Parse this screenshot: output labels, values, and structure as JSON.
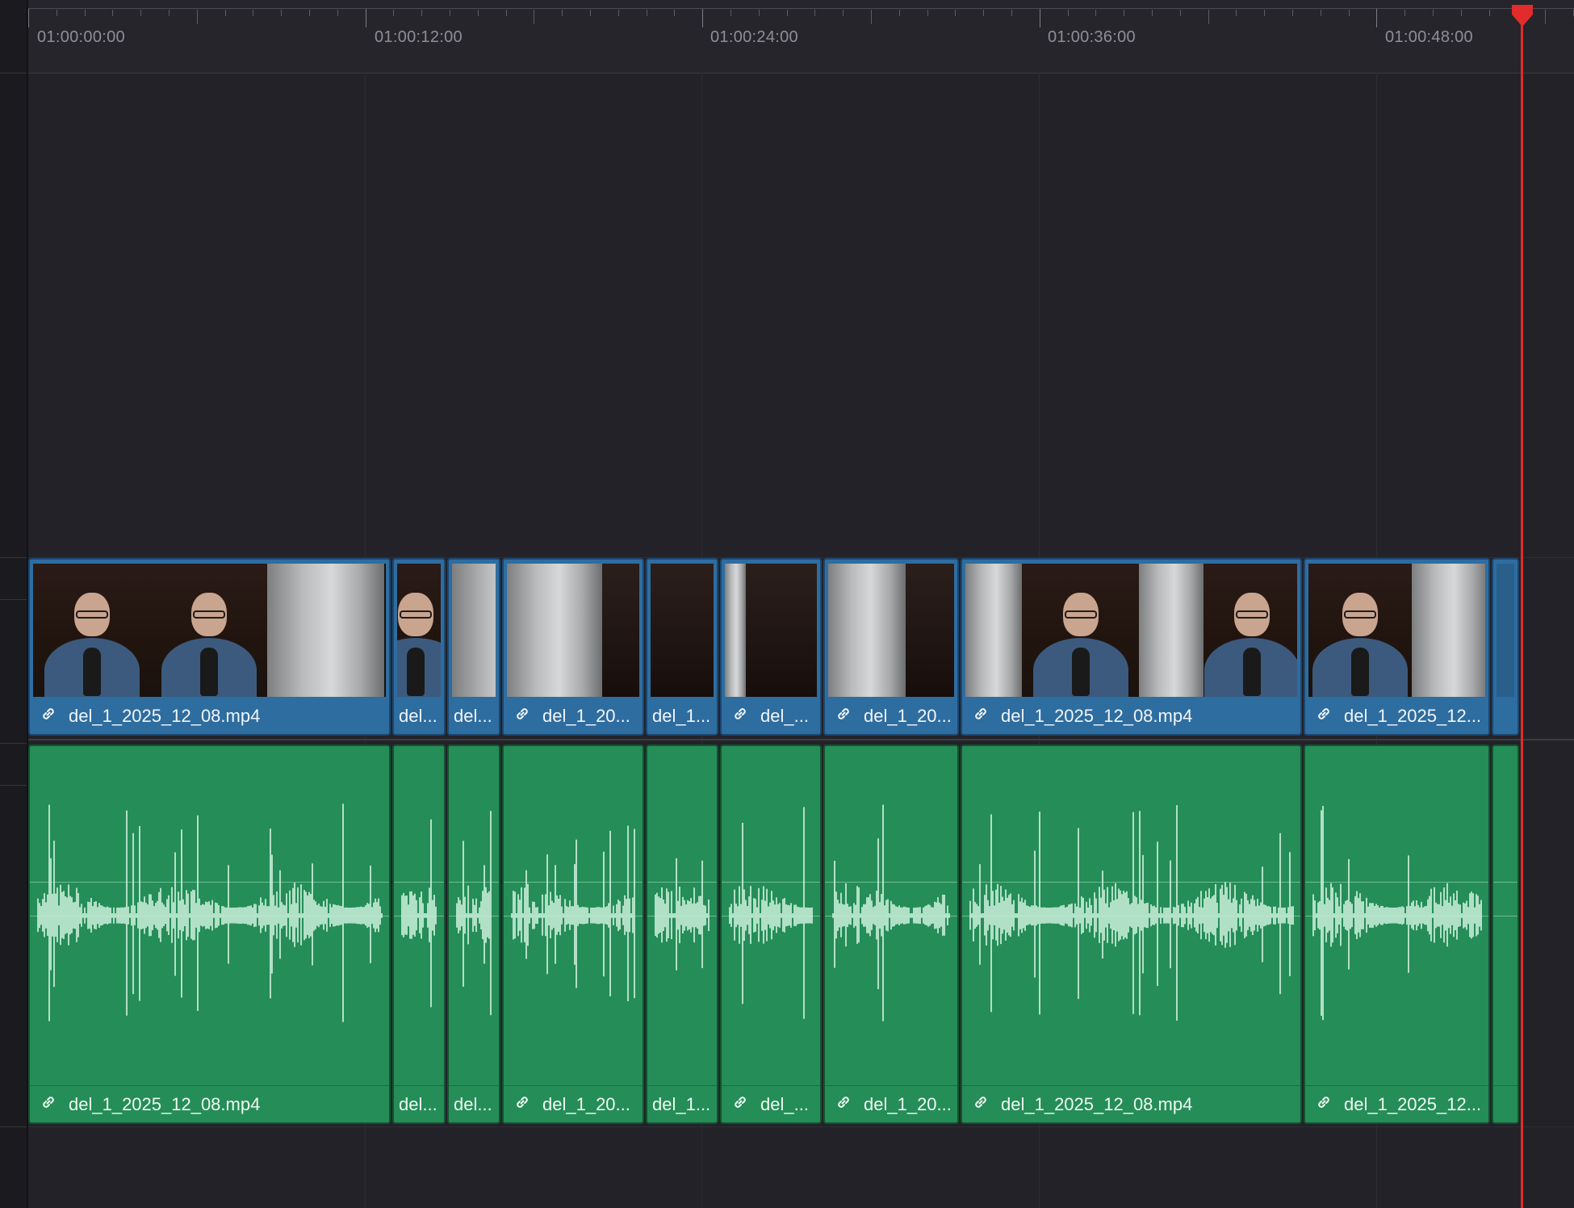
{
  "ruler": {
    "timecodes": [
      "01:00:00:00",
      "01:00:12:00",
      "01:00:24:00",
      "01:00:36:00",
      "01:00:48:00"
    ]
  },
  "video_track": {
    "clips": [
      {
        "label": "del_1_2025_12_08.mp4",
        "linked": true
      },
      {
        "label": "del...",
        "linked": false
      },
      {
        "label": "del...",
        "linked": false
      },
      {
        "label": "del_1_20...",
        "linked": true
      },
      {
        "label": "del_1...",
        "linked": false
      },
      {
        "label": "del_...",
        "linked": true
      },
      {
        "label": "del_1_20...",
        "linked": true
      },
      {
        "label": "del_1_2025_12_08.mp4",
        "linked": true
      },
      {
        "label": "del_1_2025_12...",
        "linked": true
      },
      {
        "label": "",
        "linked": false
      }
    ]
  },
  "audio_track": {
    "clips": [
      {
        "label": "del_1_2025_12_08.mp4",
        "linked": true
      },
      {
        "label": "del...",
        "linked": false
      },
      {
        "label": "del...",
        "linked": false
      },
      {
        "label": "del_1_20...",
        "linked": true
      },
      {
        "label": "del_1...",
        "linked": false
      },
      {
        "label": "del_...",
        "linked": true
      },
      {
        "label": "del_1_20...",
        "linked": true
      },
      {
        "label": "del_1_2025_12_08.mp4",
        "linked": true
      },
      {
        "label": "del_1_2025_12...",
        "linked": true
      },
      {
        "label": "",
        "linked": false
      }
    ]
  },
  "colors": {
    "video_clip": "#2e6da0",
    "audio_clip": "#258d58",
    "playhead": "#e22b2b",
    "waveform": "#d4f5e2"
  }
}
